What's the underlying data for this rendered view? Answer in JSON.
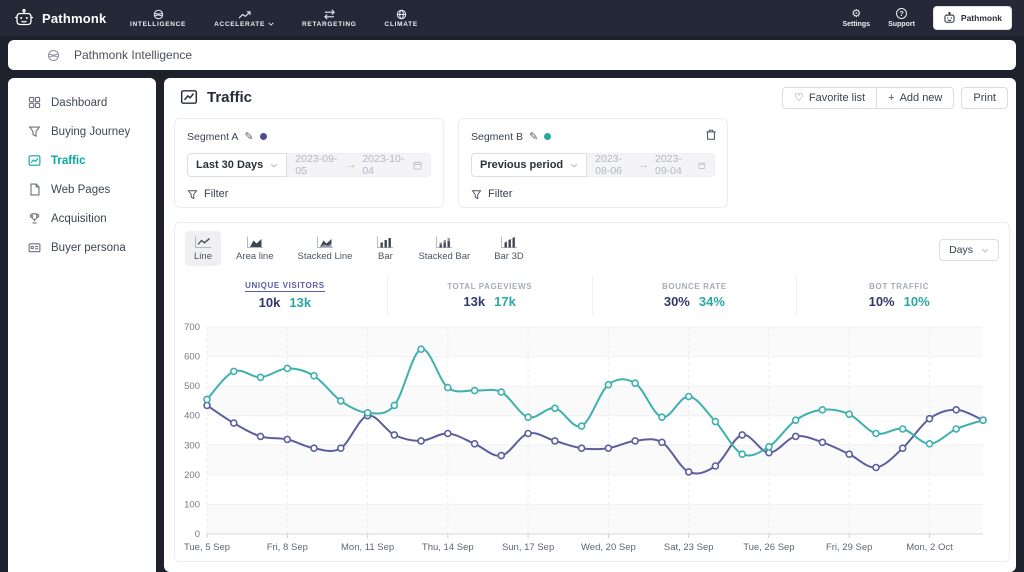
{
  "colors": {
    "teal_line": "#3fb1ac",
    "purple_line": "#5c5f9e",
    "stat_value_a": "#33386b",
    "stat_value_b": "#2aa7a2",
    "active_stat": "#5b5ea6",
    "nav_background": "#252837"
  },
  "icons": {
    "heart": "♡",
    "plus": "+",
    "pencil": "✎",
    "arrow_right": "→",
    "gear": "⚙",
    "help": "?"
  },
  "topnav": {
    "brand": "Pathmonk",
    "menu": [
      {
        "label": "INTELLIGENCE"
      },
      {
        "label": "ACCELERATE",
        "has_dropdown": true
      },
      {
        "label": "RETARGETING"
      },
      {
        "label": "CLIMATE"
      }
    ],
    "settings": "Settings",
    "support": "Support",
    "account": "Pathmonk"
  },
  "appbar": {
    "title": "Pathmonk Intelligence"
  },
  "sidebar": {
    "items": [
      {
        "label": "Dashboard"
      },
      {
        "label": "Buying Journey"
      },
      {
        "label": "Traffic",
        "active": true
      },
      {
        "label": "Web Pages"
      },
      {
        "label": "Acquisition"
      },
      {
        "label": "Buyer persona"
      }
    ]
  },
  "main": {
    "title": "Traffic",
    "actions": {
      "favorite": "Favorite list",
      "add_new": "Add new",
      "print": "Print"
    },
    "segments": [
      {
        "name": "Segment A",
        "preset": "Last 30 Days",
        "date_start": "2023-09-05",
        "date_end": "2023-10-04",
        "filter": "Filter",
        "dot_color": "#4a4d92",
        "deletable": false
      },
      {
        "name": "Segment B",
        "preset": "Previous period",
        "date_start": "2023-08-06",
        "date_end": "2023-09-04",
        "filter": "Filter",
        "dot_color": "#2aa7a2",
        "deletable": true
      }
    ],
    "chart_tabs": [
      {
        "label": "Line",
        "active": true
      },
      {
        "label": "Area line"
      },
      {
        "label": "Stacked Line"
      },
      {
        "label": "Bar"
      },
      {
        "label": "Stacked Bar"
      },
      {
        "label": "Bar 3D"
      }
    ],
    "granularity": "Days",
    "stats": [
      {
        "label": "UNIQUE VISITORS",
        "a": "10k",
        "b": "13k",
        "active": true
      },
      {
        "label": "TOTAL PAGEVIEWS",
        "a": "13k",
        "b": "17k"
      },
      {
        "label": "BOUNCE RATE",
        "a": "30%",
        "b": "34%"
      },
      {
        "label": "BOT TRAFFIC",
        "a": "10%",
        "b": "10%"
      }
    ]
  },
  "chart_data": {
    "type": "line",
    "points": 30,
    "x_start": "2023-09-05",
    "x_end": "2023-10-04",
    "tick_labels": [
      {
        "index": 0,
        "label": "Tue, 5 Sep"
      },
      {
        "index": 3,
        "label": "Fri, 8 Sep"
      },
      {
        "index": 6,
        "label": "Mon, 11 Sep"
      },
      {
        "index": 9,
        "label": "Thu, 14 Sep"
      },
      {
        "index": 12,
        "label": "Sun, 17 Sep"
      },
      {
        "index": 15,
        "label": "Wed, 20 Sep"
      },
      {
        "index": 18,
        "label": "Sat, 23 Sep"
      },
      {
        "index": 21,
        "label": "Tue, 26 Sep"
      },
      {
        "index": 24,
        "label": "Fri, 29 Sep"
      },
      {
        "index": 27,
        "label": "Mon, 2 Oct"
      }
    ],
    "ylim": [
      0,
      700
    ],
    "yticks": [
      0,
      100,
      200,
      300,
      400,
      500,
      600,
      700
    ],
    "grid": true,
    "legend": "none",
    "series": [
      {
        "name": "Segment A",
        "color": "#5c5f9e",
        "values": [
          435,
          375,
          330,
          320,
          290,
          290,
          400,
          335,
          315,
          340,
          305,
          265,
          340,
          315,
          290,
          290,
          315,
          310,
          210,
          230,
          335,
          275,
          330,
          310,
          270,
          225,
          290,
          390,
          420,
          385
        ]
      },
      {
        "name": "Segment B",
        "color": "#3fb1ac",
        "values": [
          455,
          550,
          530,
          560,
          535,
          450,
          410,
          435,
          625,
          495,
          485,
          480,
          395,
          425,
          365,
          505,
          510,
          395,
          465,
          380,
          270,
          295,
          385,
          420,
          405,
          340,
          355,
          305,
          355,
          385
        ]
      }
    ]
  }
}
